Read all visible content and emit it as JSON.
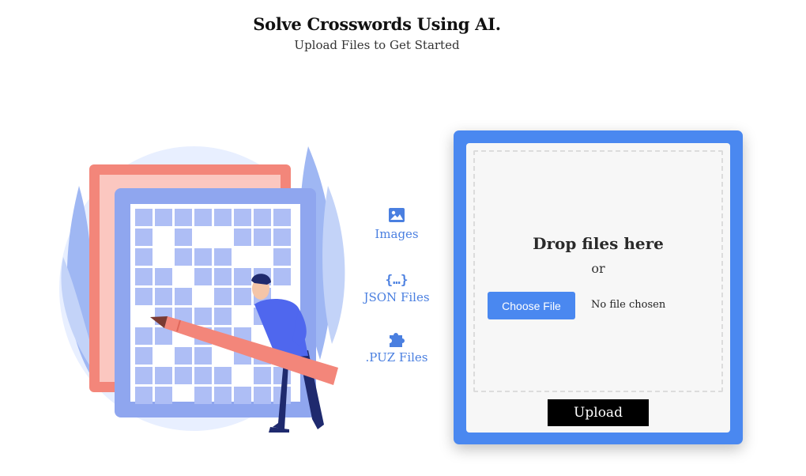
{
  "header": {
    "title": "Solve Crosswords Using AI.",
    "subtitle": "Upload Files to Get Started"
  },
  "file_types": [
    {
      "label": "Images",
      "icon": "image-icon"
    },
    {
      "label": "JSON Files",
      "icon": "curly-braces-icon"
    },
    {
      "label": ".PUZ Files",
      "icon": "puzzle-piece-icon"
    }
  ],
  "upload": {
    "drop_title": "Drop files here",
    "or_text": "or",
    "choose_label": "Choose File",
    "no_file_text": "No file chosen",
    "upload_label": "Upload"
  },
  "colors": {
    "accent": "#4a88f0",
    "icon_blue": "#4a7fe0",
    "upload_button": "#000000",
    "illustration_red": "#f3867a",
    "illustration_blue": "#8fa6ef"
  }
}
